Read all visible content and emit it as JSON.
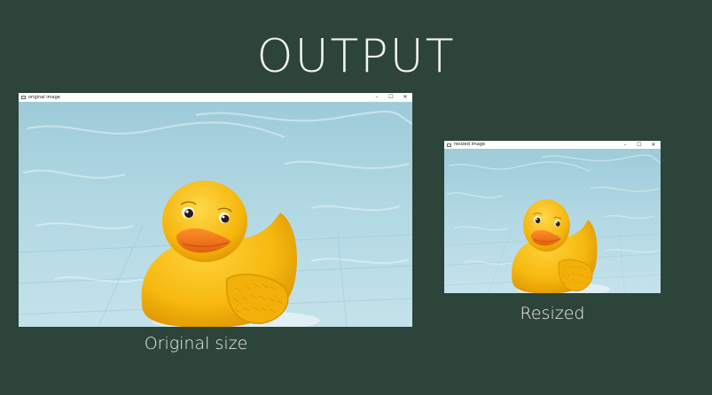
{
  "slide": {
    "title": "OUTPUT"
  },
  "windows": {
    "original": {
      "title": "original image",
      "caption": "Original size"
    },
    "resized": {
      "title": "resized image",
      "caption": "Resized"
    },
    "controls": {
      "minimize": "–",
      "maximize": "☐",
      "close": "✕"
    }
  },
  "icons": [
    "app-icon",
    "minimize-icon",
    "maximize-icon",
    "close-icon"
  ],
  "colors": {
    "background": "#2c4439",
    "water": "#a9d2df",
    "duck": "#f6b90f",
    "beak": "#f47a1e"
  }
}
